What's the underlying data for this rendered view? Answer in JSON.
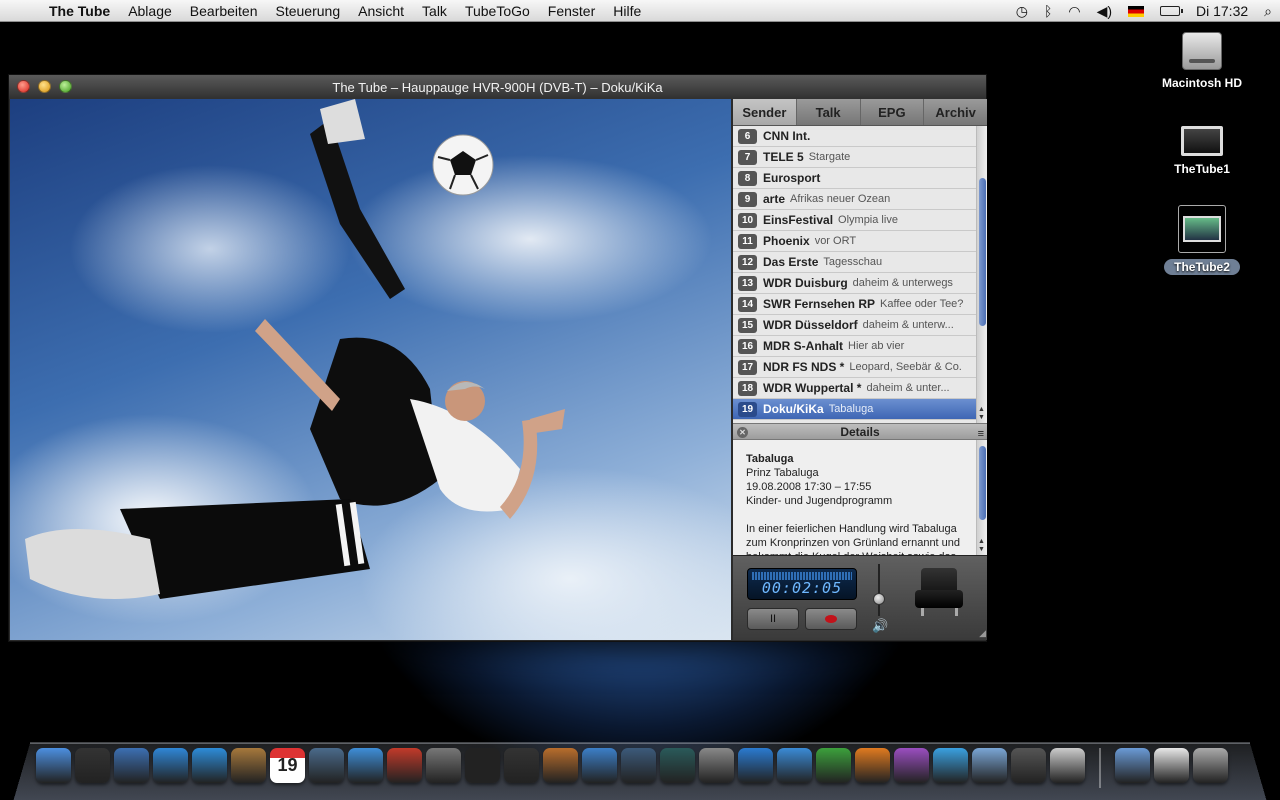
{
  "menubar": {
    "apple_symbol": "",
    "items": [
      "The Tube",
      "Ablage",
      "Bearbeiten",
      "Steuerung",
      "Ansicht",
      "Talk",
      "TubeToGo",
      "Fenster",
      "Hilfe"
    ],
    "clock": "Di 17:32"
  },
  "desktop": {
    "icons": [
      "Macintosh HD",
      "TheTube1",
      "TheTube2"
    ]
  },
  "window": {
    "title": "The Tube – Hauppauge HVR-900H (DVB-T) – Doku/KiKa"
  },
  "tabs": [
    "Sender",
    "Talk",
    "EPG",
    "Archiv"
  ],
  "channels": [
    {
      "num": "6",
      "name": "CNN Int.",
      "program": ""
    },
    {
      "num": "7",
      "name": "TELE 5",
      "program": "Stargate"
    },
    {
      "num": "8",
      "name": "Eurosport",
      "program": ""
    },
    {
      "num": "9",
      "name": "arte",
      "program": "Afrikas neuer Ozean"
    },
    {
      "num": "10",
      "name": "EinsFestival",
      "program": "Olympia live"
    },
    {
      "num": "11",
      "name": "Phoenix",
      "program": "vor ORT"
    },
    {
      "num": "12",
      "name": "Das Erste",
      "program": "Tagesschau"
    },
    {
      "num": "13",
      "name": "WDR Duisburg",
      "program": "daheim & unterwegs"
    },
    {
      "num": "14",
      "name": "SWR Fernsehen RP",
      "program": "Kaffee oder Tee?"
    },
    {
      "num": "15",
      "name": "WDR Düsseldorf",
      "program": "daheim & unterw..."
    },
    {
      "num": "16",
      "name": "MDR S-Anhalt",
      "program": "Hier ab vier"
    },
    {
      "num": "17",
      "name": "NDR FS NDS *",
      "program": "Leopard, Seebär & Co."
    },
    {
      "num": "18",
      "name": "WDR Wuppertal *",
      "program": "daheim & unter..."
    },
    {
      "num": "19",
      "name": "Doku/KiKa",
      "program": "Tabaluga"
    }
  ],
  "selected_channel_index": 13,
  "details": {
    "header": "Details",
    "title": "Tabaluga",
    "subtitle": "Prinz Tabaluga",
    "time": "19.08.2008 17:30 – 17:55",
    "genre": "Kinder- und Jugendprogramm",
    "description": "In einer feierlichen Handlung wird Tabaluga zum Kronprinzen von Grünland ernannt und bekommt die Kugel der Weisheit sowie das"
  },
  "controls": {
    "timecode": "00:02:05",
    "pause_symbol": "II",
    "volume_level": 0.35
  },
  "dock": {
    "icons": [
      "finder-icon",
      "dashboard-icon",
      "mail-icon",
      "safari-icon",
      "ichat-icon",
      "addressbook-icon",
      "ical-icon",
      "iphoto-icon",
      "itunes-icon",
      "photobooth-icon",
      "thetube-app-icon",
      "chair-app-icon",
      "imovie-icon",
      "garageband-icon",
      "xcode-icon",
      "spaces-icon",
      "timemachine-icon",
      "systempreferences-icon",
      "network-icon",
      "word-icon",
      "excel-icon",
      "powerpoint-icon",
      "entourage-icon",
      "messenger-icon",
      "folder-icon",
      "chair2-icon",
      "preview-icon",
      "documents-icon",
      "docx-icon",
      "trash-icon"
    ],
    "ical_date": "19"
  }
}
